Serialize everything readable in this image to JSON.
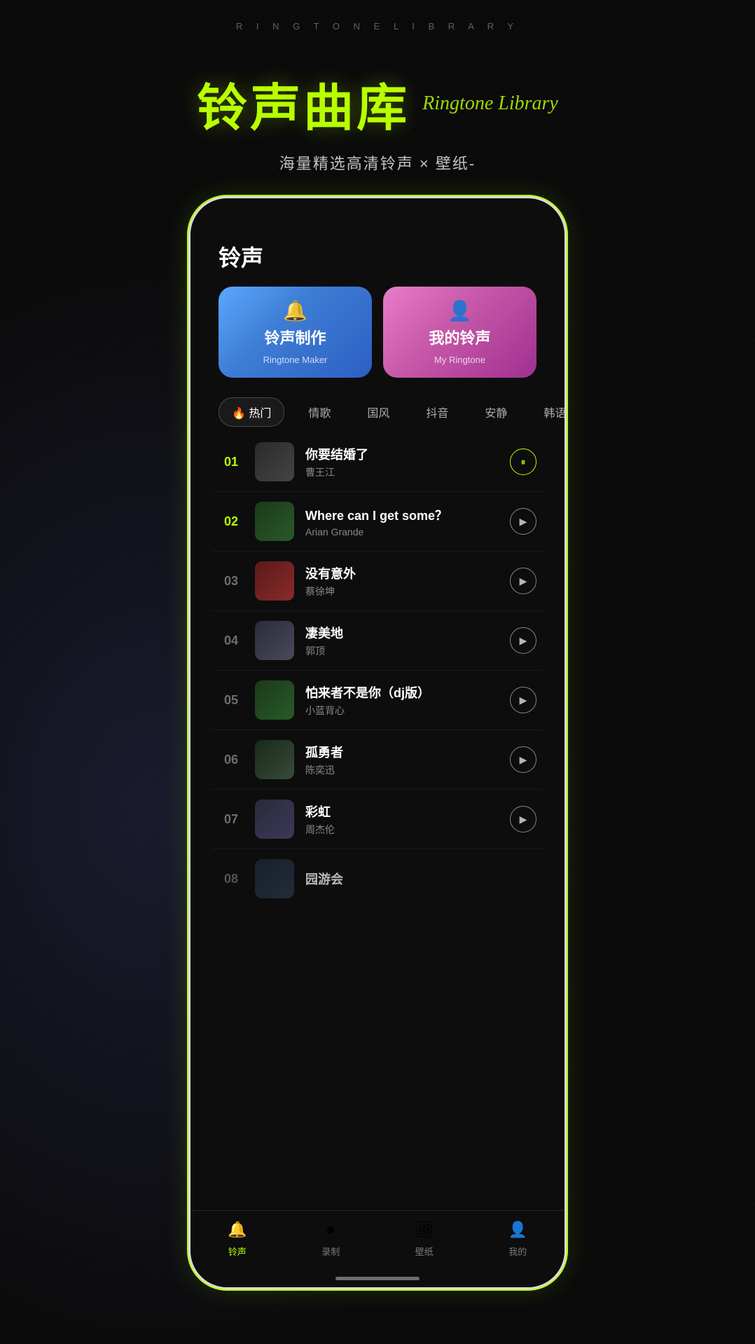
{
  "header": {
    "subtitle": "R  I  N  G  T  O  N  E    L  I  B  R  A  R  Y",
    "title_cn": "铃声曲库",
    "title_en": "Ringtone Library",
    "description": "海量精选高清铃声 × 壁纸-"
  },
  "cards": {
    "ringtone_maker": {
      "title_cn": "铃声制作",
      "title_en": "Ringtone Maker"
    },
    "my_ringtone": {
      "title_cn": "我的铃声",
      "title_en": "My Ringtone"
    }
  },
  "categories": [
    {
      "label": "🔥 热门",
      "active": true
    },
    {
      "label": "情歌",
      "active": false
    },
    {
      "label": "国风",
      "active": false
    },
    {
      "label": "抖音",
      "active": false
    },
    {
      "label": "安静",
      "active": false
    },
    {
      "label": "韩语",
      "active": false
    }
  ],
  "songs": [
    {
      "number": "01",
      "title": "你要结婚了",
      "artist": "曹王江",
      "highlight": true,
      "playing": true,
      "thumbClass": "thumb-1",
      "thumbEmoji": "👤"
    },
    {
      "number": "02",
      "title": "Where can I get some？",
      "artist": "Arian Grande",
      "highlight": true,
      "playing": false,
      "thumbClass": "thumb-2",
      "thumbEmoji": "🎵"
    },
    {
      "number": "03",
      "title": "没有意外",
      "artist": "蔡徐坤",
      "highlight": false,
      "playing": false,
      "thumbClass": "thumb-3",
      "thumbEmoji": "👤"
    },
    {
      "number": "04",
      "title": "凄美地",
      "artist": "郭顶",
      "highlight": false,
      "playing": false,
      "thumbClass": "thumb-4",
      "thumbEmoji": "👤"
    },
    {
      "number": "05",
      "title": "怕来者不是你（dj版）",
      "artist": "小蓝背心",
      "highlight": false,
      "playing": false,
      "thumbClass": "thumb-5",
      "thumbEmoji": "🎵"
    },
    {
      "number": "06",
      "title": "孤勇者",
      "artist": "陈奕迅",
      "highlight": false,
      "playing": false,
      "thumbClass": "thumb-6",
      "thumbEmoji": "🎵"
    },
    {
      "number": "07",
      "title": "彩虹",
      "artist": "周杰伦",
      "highlight": false,
      "playing": false,
      "thumbClass": "thumb-7",
      "thumbEmoji": "👤"
    },
    {
      "number": "08",
      "title": "园游会",
      "artist": "",
      "highlight": false,
      "playing": false,
      "thumbClass": "thumb-8",
      "thumbEmoji": "👤",
      "partial": true
    }
  ],
  "nav": {
    "items": [
      {
        "label": "铃声",
        "active": true,
        "icon": "🔔"
      },
      {
        "label": "录制",
        "active": false,
        "icon": "⏺"
      },
      {
        "label": "壁纸",
        "active": false,
        "icon": "🖼"
      },
      {
        "label": "我的",
        "active": false,
        "icon": "👤"
      }
    ]
  },
  "page_title": "铃声"
}
